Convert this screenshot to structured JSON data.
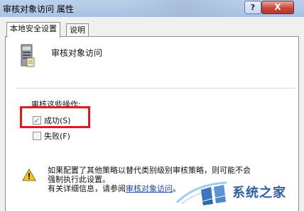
{
  "window": {
    "title": "审核对象访问 属性",
    "help_glyph": "?",
    "close_glyph": "X"
  },
  "tabs": [
    {
      "label": "本地安全设置",
      "active": true
    },
    {
      "label": "说明",
      "active": false
    }
  ],
  "policy": {
    "heading": "审核对象访问",
    "ops_label": "审核这些操作:",
    "options": [
      {
        "label": "成功(S)",
        "checked": true
      },
      {
        "label": "失败(F)",
        "checked": false
      }
    ]
  },
  "warning": {
    "line1": "如果配置了其他策略以替代类别级别审核策略，则可能不会",
    "line2": "强制执行此设置。",
    "line3_prefix": "有关详细信息，请参阅",
    "link": "审核对象访问",
    "line3_suffix": "。"
  },
  "watermark": {
    "text": "系统之家"
  },
  "colors": {
    "highlight": "#e11a22",
    "link": "#1a3db8",
    "titlebar": "#bcd1ea"
  }
}
